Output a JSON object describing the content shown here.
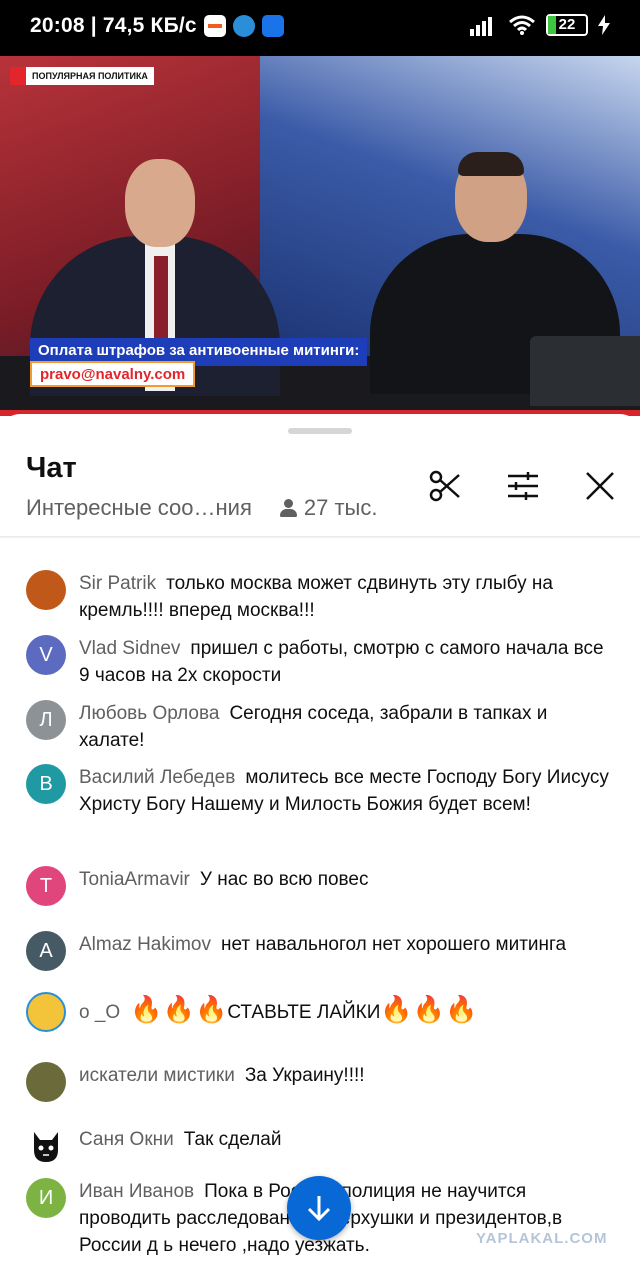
{
  "status_bar": {
    "time_speed": "20:08 | 74,5 КБ/с",
    "battery": "22"
  },
  "video": {
    "channel_logo": "ПОПУЛЯРНАЯ ПОЛИТИКА",
    "lower_third": "Оплата штрафов за антивоенные митинги:",
    "email": "pravo@navalny.com"
  },
  "chat": {
    "title": "Чат",
    "mode": "Интересные соо…ния",
    "viewers": "27 тыс."
  },
  "colors": {
    "accent": "#0869d6",
    "author": "#606060",
    "video_banner": "#1e3db8",
    "stream_red": "#d6262c"
  },
  "messages": [
    {
      "author": "Sir Patrik",
      "text": "только москва может сдвинуть эту глыбу на кремль!!!! вперед москва!!!",
      "avatar_letter": "",
      "avatar_color": "#c0581a"
    },
    {
      "author": "Vlad Sidnev",
      "text": "пришел с работы, смотрю с самого начала все 9 часов на 2х скорости",
      "avatar_letter": "V",
      "avatar_color": "#5c6bc0"
    },
    {
      "author": "Любовь Орлова",
      "text": "Сегодня соседа, забрали в тапках и халате!",
      "avatar_letter": "Л",
      "avatar_color": "#8d9297"
    },
    {
      "author": "Василий Лебедев",
      "text": "молитесь все месте Господу Богу Иисусу Христу Богу Нашему и Милость Божия будет всем!",
      "avatar_letter": "В",
      "avatar_color": "#1f9aa3"
    },
    {
      "author": "ToniaArmavir",
      "text": "У нас во всю повес",
      "avatar_letter": "T",
      "avatar_color": "#e0457b"
    },
    {
      "author": "Almaz Hakimov",
      "text": "нет навальногол нет хорошего митинга",
      "avatar_letter": "A",
      "avatar_color": "#455a64"
    },
    {
      "author": "o _O",
      "text_before": "🔥🔥🔥",
      "text_middle": "СТАВЬТЕ ЛАЙКИ",
      "text_after": "🔥🔥🔥",
      "avatar_letter": "",
      "avatar_color": "#f3c33a"
    },
    {
      "author": "искатели мистики",
      "text": "За Украину!!!!",
      "avatar_letter": "",
      "avatar_color": "#6b6a3a"
    },
    {
      "author": "Саня Окни",
      "text": "Так сделай",
      "avatar_letter": "",
      "avatar_color": "#ffffff"
    },
    {
      "author": "Иван Иванов",
      "text": "Пока в России ,полиция не научится проводить расследован  тив верхушки и президентов,в России д  ь нечего ,надо уезжать.",
      "avatar_letter": "И",
      "avatar_color": "#7cb342"
    }
  ],
  "icons": {
    "clip": "scissors-icon",
    "filter": "sliders-icon",
    "close": "close-icon",
    "scroll": "arrow-down-icon"
  },
  "watermark": "YAPLAKAL.COM"
}
